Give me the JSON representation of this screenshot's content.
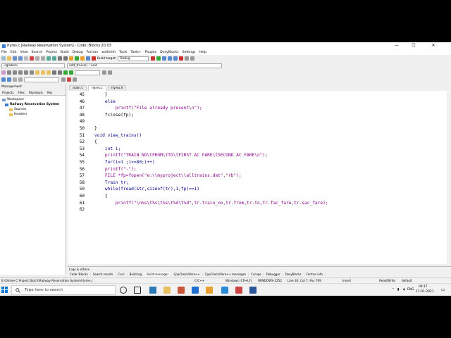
{
  "window": {
    "title": "rlyres.c [Railway Reservation System] - Code::Blocks 20.03",
    "min": "—",
    "max": "☐",
    "close": "✕"
  },
  "menu": [
    "File",
    "Edit",
    "View",
    "Search",
    "Project",
    "Build",
    "Debug",
    "Fortran",
    "wxSmith",
    "Tools",
    "Tools+",
    "Plugins",
    "DoxyBlocks",
    "Settings",
    "Help"
  ],
  "toolbar": {
    "build_target": "Debug",
    "scope": "<global>",
    "function": "add_trains() : void"
  },
  "management": {
    "title": "Management",
    "tabs": [
      "Projects",
      "Files",
      "FSymbols",
      "Res"
    ],
    "workspace": "Workspace",
    "project": "Railway Reservation System",
    "folders": [
      "Sources",
      "Headers"
    ]
  },
  "editor": {
    "tabs": [
      "main.c",
      "rlyres.c",
      "rlyres.h"
    ],
    "active_tab": "rlyres.c",
    "lines": [
      {
        "n": "45",
        "code": "    }"
      },
      {
        "n": "46",
        "code": "    else"
      },
      {
        "n": "47",
        "code": "        printf(\"File already present\\n\");"
      },
      {
        "n": "48",
        "code": "    fclose(fp);"
      },
      {
        "n": "49",
        "code": ""
      },
      {
        "n": "50",
        "code": "}"
      },
      {
        "n": "51",
        "code": "void view_trains()"
      },
      {
        "n": "52",
        "code": "{"
      },
      {
        "n": "53",
        "code": "    int i;"
      },
      {
        "n": "54",
        "code": "    printf(\"TRAIN NO\\tFROM\\tTO\\tFIRST AC FARE\\tSECOND AC FARE\\n\");"
      },
      {
        "n": "55",
        "code": "    for(i=1 ;i<=80;i++)"
      },
      {
        "n": "56",
        "code": "    printf(\"-\");"
      },
      {
        "n": "57",
        "code": "    FILE *fp=fopen(\"e:\\\\myproject\\\\alltrains.dat\",\"rb\");"
      },
      {
        "n": "58",
        "code": "    Train tr;"
      },
      {
        "n": "59",
        "code": "    while(fread(&tr,sizeof(tr),1,fp)==1)"
      },
      {
        "n": "60",
        "code": "    {"
      },
      {
        "n": "61",
        "code": "        printf(\"\\n%s\\t%s\\t%s\\t%d\\t%d\",tr.train_no,tr.from,tr.to,tr.fac_fare,tr.sac_fare);"
      },
      {
        "n": "62",
        "code": ""
      }
    ]
  },
  "logs": {
    "title": "Logs & others",
    "tabs": [
      "Code::Blocks",
      "Search results",
      "Cccc",
      "Build log",
      "Build messages",
      "CppCheck/Vera++",
      "CppCheck/Vera++ messages",
      "Cscope",
      "Debugger",
      "DoxyBlocks",
      "Fortran info"
    ],
    "active_tab": "Build messages",
    "columns": [
      "File",
      "Line",
      "Message"
    ]
  },
  "status": {
    "path": "E:\\Online C Project Batch\\Railway Reservation System\\rlyres.c",
    "lang": "C/C++",
    "eol": "Windows (CR+LF)",
    "encoding": "WINDOWS-1252",
    "position": "Line 30, Col 7, Pos 709",
    "mode": "Insert",
    "access": "Read/Write",
    "profile": "default"
  },
  "taskbar": {
    "search_placeholder": "Type here to search",
    "lang": "ENG",
    "time": "09:17",
    "date": "17-01-2021"
  },
  "colors": {
    "keyword": "#00008b",
    "string": "#8b008b",
    "accent": "#0078d7"
  }
}
